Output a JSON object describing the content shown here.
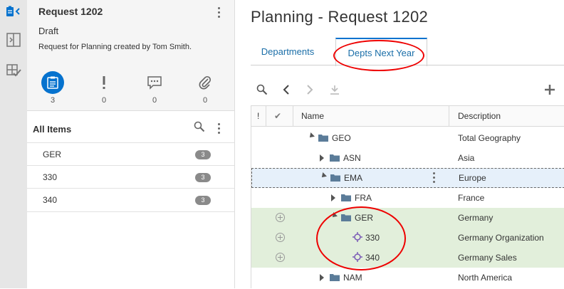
{
  "rail": {
    "icons": [
      "clipboard-icon",
      "panel-split-icon",
      "approve-grid-icon"
    ]
  },
  "request": {
    "title": "Request 1202",
    "status": "Draft",
    "description": "Request for Planning created by Tom Smith.",
    "counters": [
      {
        "icon": "clipboard-icon",
        "count": "3"
      },
      {
        "icon": "exclamation-icon",
        "count": "0"
      },
      {
        "icon": "comment-icon",
        "count": "0"
      },
      {
        "icon": "paperclip-icon",
        "count": "0"
      }
    ]
  },
  "items_panel": {
    "heading": "All Items",
    "items": [
      {
        "label": "GER",
        "badge": "3"
      },
      {
        "label": "330",
        "badge": "3"
      },
      {
        "label": "340",
        "badge": "3"
      }
    ]
  },
  "main": {
    "title": "Planning - Request 1202",
    "tabs": [
      {
        "label": "Departments",
        "active": false
      },
      {
        "label": "Depts Next Year",
        "active": true
      }
    ],
    "grid": {
      "headers": {
        "flag": "!",
        "check": "✔",
        "name": "Name",
        "description": "Description"
      },
      "rows": [
        {
          "name": "GEO",
          "desc": "Total Geography",
          "state": "expanded",
          "icon": "folder",
          "style": ""
        },
        {
          "name": "ASN",
          "desc": "Asia",
          "state": "collapsed",
          "icon": "folder",
          "style": ""
        },
        {
          "name": "EMA",
          "desc": "Europe",
          "state": "expanded",
          "icon": "folder",
          "style": "selected"
        },
        {
          "name": "FRA",
          "desc": "France",
          "state": "collapsed",
          "icon": "folder",
          "style": ""
        },
        {
          "name": "GER",
          "desc": "Germany",
          "state": "expanded",
          "icon": "folder",
          "style": "green"
        },
        {
          "name": "330",
          "desc": "Germany Organization",
          "state": "leaf",
          "icon": "target",
          "style": "green"
        },
        {
          "name": "340",
          "desc": "Germany Sales",
          "state": "leaf",
          "icon": "target",
          "style": "green"
        },
        {
          "name": "NAM",
          "desc": "North America",
          "state": "collapsed",
          "icon": "folder",
          "style": ""
        }
      ]
    }
  },
  "colors": {
    "accent": "#0572ce",
    "highlight": "#e2efdb",
    "selected": "#e6f0fa",
    "annotation": "#e00000"
  }
}
